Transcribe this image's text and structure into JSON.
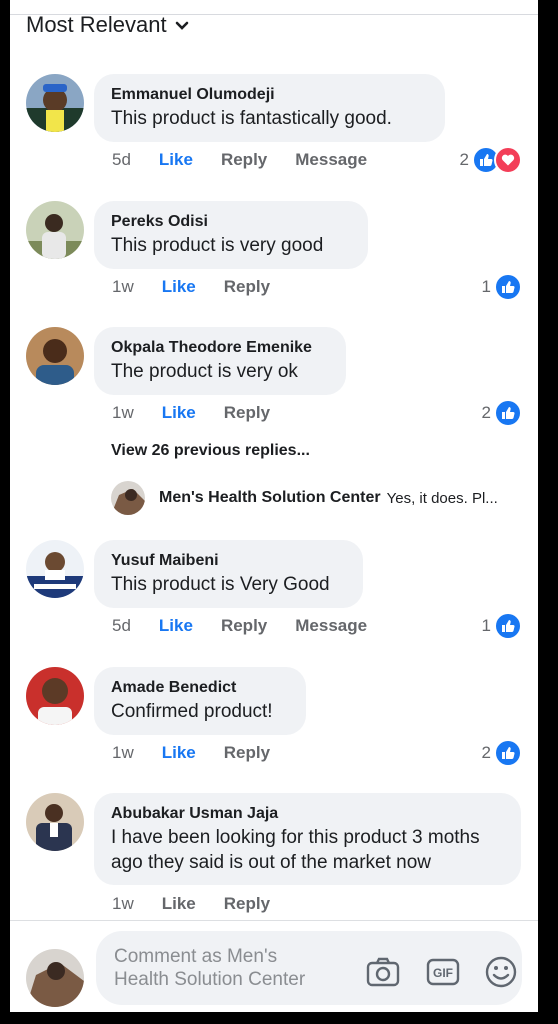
{
  "sort": {
    "label": "Most Relevant"
  },
  "comments": [
    {
      "name": "Emmanuel Olumodeji",
      "text": "This product is fantastically good.",
      "time": "5d",
      "like": "Like",
      "reply": "Reply",
      "message": "Message",
      "reactions": "2"
    },
    {
      "name": "Pereks Odisi",
      "text": "This product is very good",
      "time": "1w",
      "like": "Like",
      "reply": "Reply",
      "reactions": "1"
    },
    {
      "name": "Okpala Theodore Emenike",
      "text": "The product is very ok",
      "time": "1w",
      "like": "Like",
      "reply": "Reply",
      "reactions": "2"
    },
    {
      "name": "Yusuf Maibeni",
      "text": "This product is Very Good",
      "time": "5d",
      "like": "Like",
      "reply": "Reply",
      "message": "Message",
      "reactions": "1"
    },
    {
      "name": "Amade Benedict",
      "text": "Confirmed product!",
      "time": "1w",
      "like": "Like",
      "reply": "Reply",
      "reactions": "2"
    },
    {
      "name": "Abubakar Usman Jaja",
      "text_line1": "I have been looking for this product 3 moths",
      "text_line2": "ago they said is out of the market now",
      "time": "1w",
      "like": "Like",
      "reply": "Reply"
    }
  ],
  "replies": {
    "view_previous": "View 26 previous replies...",
    "name": "Men's Health Solution Center",
    "text": "Yes, it does. Pl..."
  },
  "composer": {
    "placeholder_line1": "Comment as Men's",
    "placeholder_line2": "Health Solution Center"
  },
  "colors": {
    "accent": "#1877f2",
    "love": "#f33e58",
    "bubble": "#f0f2f5"
  }
}
